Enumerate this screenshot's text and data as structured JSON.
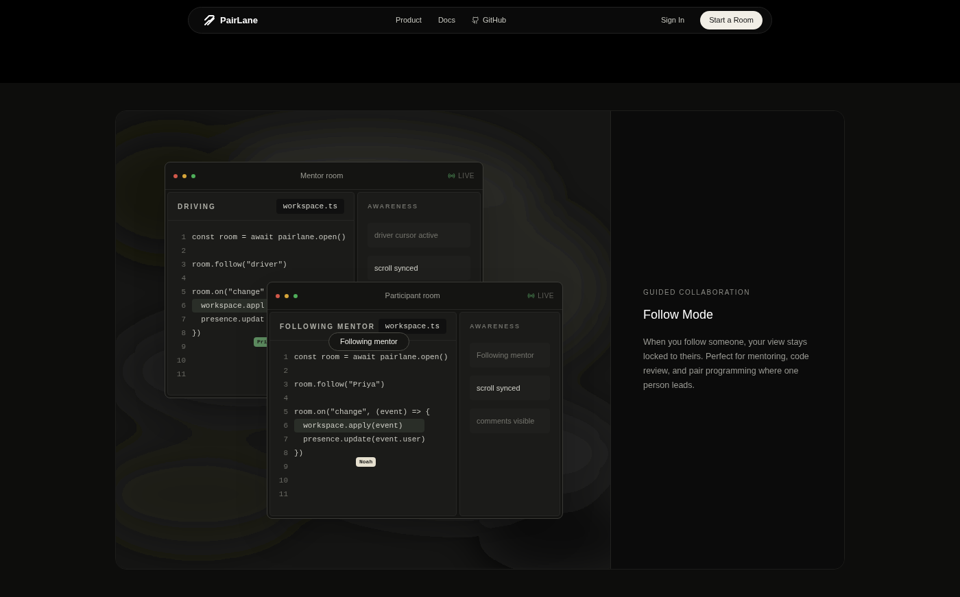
{
  "nav": {
    "brand": "PairLane",
    "links": [
      {
        "label": "Product",
        "kind": "text"
      },
      {
        "label": "Docs",
        "kind": "text"
      },
      {
        "label": "GitHub",
        "kind": "github"
      }
    ],
    "sign_in": "Sign In",
    "cta": "Start a Room"
  },
  "windows": [
    {
      "title": "Mentor room",
      "live": "LIVE",
      "pane_label": "DRIVING",
      "file_tab": "workspace.ts",
      "awareness_label": "AWARENESS",
      "cursor": {
        "name": "Pri",
        "color": "#5f8f62"
      },
      "code": [
        {
          "n": "1",
          "text": "const room = await pairlane.open()",
          "kind": "plain"
        },
        {
          "n": "2"
        },
        {
          "n": "3",
          "text": "room.follow(\"driver\")",
          "kind": "plain"
        },
        {
          "n": "4"
        },
        {
          "n": "5",
          "text": "room.on(\"change\"",
          "kind": "plain"
        },
        {
          "n": "6",
          "text": "  workspace.appl",
          "kind": "highlighted"
        },
        {
          "n": "7",
          "text": "  presence.updat",
          "kind": "plain"
        },
        {
          "n": "8",
          "text": "})",
          "kind": "plain"
        },
        {
          "n": "9"
        },
        {
          "n": "10"
        },
        {
          "n": "11"
        }
      ],
      "awareness": [
        {
          "text": "driver cursor active",
          "active": false
        },
        {
          "text": "scroll synced",
          "active": true
        }
      ]
    },
    {
      "title": "Participant room",
      "live": "LIVE",
      "pane_label": "FOLLOWING MENTOR",
      "file_tab": "workspace.ts",
      "awareness_label": "AWARENESS",
      "follow_pill": "Following mentor",
      "cursor": {
        "name": "Noah",
        "color": "#e6e0cf"
      },
      "code": [
        {
          "n": "1",
          "text": "const room = await pairlane.open()",
          "kind": "plain"
        },
        {
          "n": "2"
        },
        {
          "n": "3",
          "text": "room.follow(\"Priya\")",
          "kind": "plain"
        },
        {
          "n": "4"
        },
        {
          "n": "5",
          "text": "room.on(\"change\", (event) => {",
          "kind": "plain"
        },
        {
          "n": "6",
          "text": "  workspace.apply(event)",
          "kind": "highlighted"
        },
        {
          "n": "7",
          "text": "  presence.update(event.user)",
          "kind": "plain"
        },
        {
          "n": "8",
          "text": "})",
          "kind": "plain"
        },
        {
          "n": "9"
        },
        {
          "n": "10"
        },
        {
          "n": "11"
        }
      ],
      "awareness": [
        {
          "text": "Following mentor",
          "active": false
        },
        {
          "text": "scroll synced",
          "active": true
        },
        {
          "text": "comments visible",
          "active": false
        }
      ]
    }
  ],
  "feature": {
    "eyebrow": "GUIDED COLLABORATION",
    "title": "Follow Mode",
    "body": "When you follow someone, your view stays locked to theirs. Perfect for mentoring, code review, and pair programming where one person leads."
  }
}
